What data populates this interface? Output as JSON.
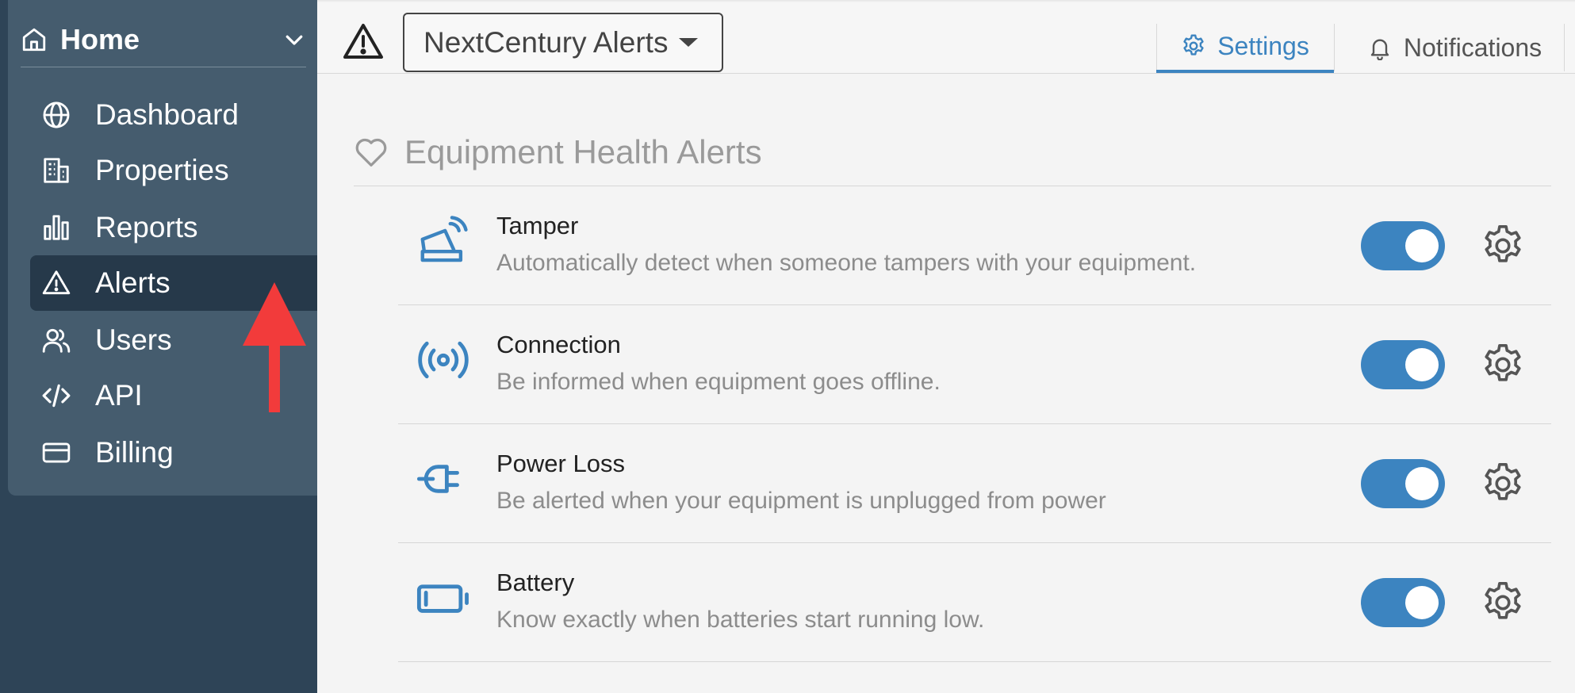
{
  "sidebar": {
    "home_label": "Home",
    "items": [
      {
        "label": "Dashboard",
        "icon": "globe-icon"
      },
      {
        "label": "Properties",
        "icon": "building-icon"
      },
      {
        "label": "Reports",
        "icon": "bar-chart-icon"
      },
      {
        "label": "Alerts",
        "icon": "alert-triangle-icon",
        "active": true
      },
      {
        "label": "Users",
        "icon": "users-icon"
      },
      {
        "label": "API",
        "icon": "code-icon"
      },
      {
        "label": "Billing",
        "icon": "credit-card-icon"
      }
    ]
  },
  "header": {
    "org_selector": "NextCentury Alerts",
    "tabs": [
      {
        "label": "Settings",
        "active": true,
        "icon": "gear-icon"
      },
      {
        "label": "Notifications",
        "active": false,
        "icon": "bell-icon"
      }
    ]
  },
  "section": {
    "title": "Equipment Health Alerts",
    "icon": "heart-icon",
    "alerts": [
      {
        "title": "Tamper",
        "description": "Automatically detect when someone tampers with your equipment.",
        "enabled": true,
        "icon": "tamper-icon"
      },
      {
        "title": "Connection",
        "description": "Be informed when equipment goes offline.",
        "enabled": true,
        "icon": "wireless-signal-icon"
      },
      {
        "title": "Power Loss",
        "description": "Be alerted when your equipment is unplugged from power",
        "enabled": true,
        "icon": "plug-icon"
      },
      {
        "title": "Battery",
        "description": "Know exactly when batteries start running low.",
        "enabled": true,
        "icon": "battery-icon"
      }
    ]
  },
  "colors": {
    "sidebar_bg": "#2e4457",
    "sidebar_panel": "#455c6e",
    "sidebar_active": "#26394a",
    "accent": "#3c84c0",
    "annotation_arrow": "#f23b3b"
  }
}
